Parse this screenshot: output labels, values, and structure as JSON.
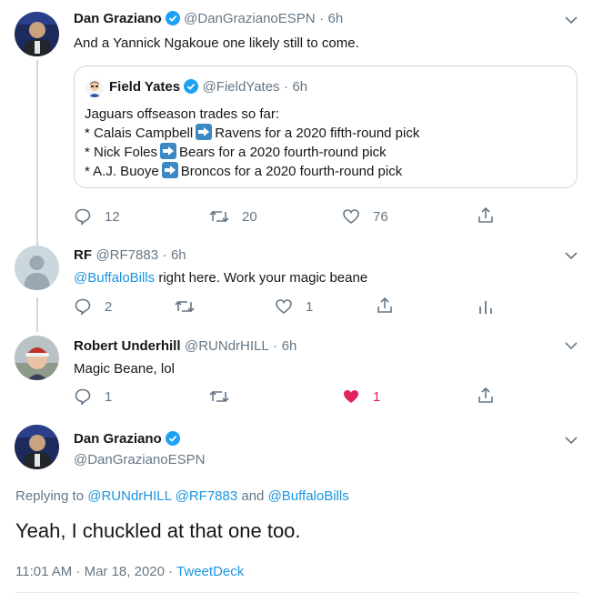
{
  "tweet1": {
    "name": "Dan Graziano",
    "handle": "@DanGrazianoESPN",
    "time": "6h",
    "text": "And a Yannick Ngakoue one likely still to come.",
    "quote": {
      "name": "Field Yates",
      "handle": "@FieldYates",
      "time": "6h",
      "line1": "Jaguars offseason trades so far:",
      "line2_a": "* Calais Campbell",
      "line2_b": "Ravens for a 2020 fifth-round pick",
      "line3_a": "* Nick Foles",
      "line3_b": "Bears for a 2020 fourth-round pick",
      "line4_a": "* A.J. Buoye",
      "line4_b": "Broncos for a 2020 fourth-round pick"
    },
    "replies": "12",
    "retweets": "20",
    "likes": "76"
  },
  "tweet2": {
    "name": "RF",
    "handle": "@RF7883",
    "time": "6h",
    "mention": "@BuffaloBills",
    "text": " right here. Work your magic beane",
    "replies": "2",
    "likes": "1"
  },
  "tweet3": {
    "name": "Robert Underhill",
    "handle": "@RUNdrHILL",
    "time": "6h",
    "text": "Magic Beane, lol",
    "replies": "1",
    "likes": "1"
  },
  "tweet4": {
    "name": "Dan Graziano",
    "handle": "@DanGrazianoESPN",
    "replying_prefix": "Replying to ",
    "replying_m1": "@RUNdrHILL",
    "replying_m2": "@RF7883",
    "replying_and": " and ",
    "replying_m3": "@BuffaloBills",
    "text": "Yeah, I chuckled at that one too.",
    "timestamp": "11:01 AM · Mar 18, 2020 · ",
    "source": "TweetDeck"
  },
  "separator": "·",
  "colors": {
    "link": "#1b95e0",
    "like_active": "#e0245e",
    "secondary": "#657786"
  }
}
